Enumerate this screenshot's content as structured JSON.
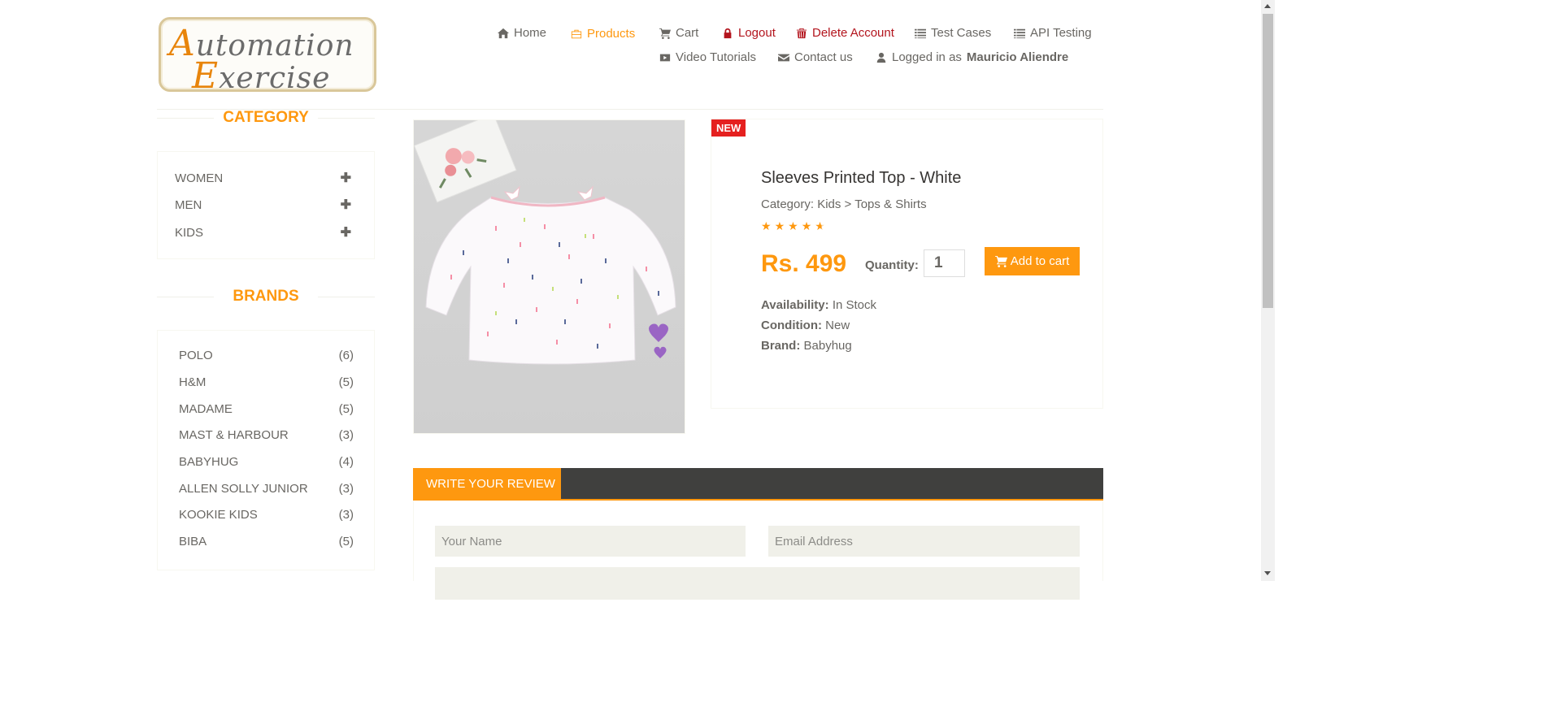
{
  "logo": {
    "line1_cap": "A",
    "line1_rest": "utomation",
    "line2_cap": "E",
    "line2_rest": "xercise"
  },
  "nav": {
    "home": "Home",
    "products": "Products",
    "cart": "Cart",
    "logout": "Logout",
    "delete_account": "Delete Account",
    "test_cases": "Test Cases",
    "api_testing": "API Testing",
    "video_tutorials": "Video Tutorials",
    "contact_us": "Contact us",
    "logged_in_prefix": "Logged in as",
    "logged_in_user": "Mauricio Aliendre"
  },
  "sidebar": {
    "category_title": "CATEGORY",
    "categories": [
      {
        "label": "WOMEN",
        "icon": "plus-icon"
      },
      {
        "label": "MEN",
        "icon": "plus-icon"
      },
      {
        "label": "KIDS",
        "icon": "plus-icon"
      }
    ],
    "brands_title": "BRANDS",
    "brands": [
      {
        "label": "POLO",
        "count": "(6)"
      },
      {
        "label": "H&M",
        "count": "(5)"
      },
      {
        "label": "MADAME",
        "count": "(5)"
      },
      {
        "label": "MAST & HARBOUR",
        "count": "(3)"
      },
      {
        "label": "BABYHUG",
        "count": "(4)"
      },
      {
        "label": "ALLEN SOLLY JUNIOR",
        "count": "(3)"
      },
      {
        "label": "KOOKIE KIDS",
        "count": "(3)"
      },
      {
        "label": "BIBA",
        "count": "(5)"
      }
    ]
  },
  "product": {
    "badge": "NEW",
    "name": "Sleeves Printed Top - White",
    "category": "Category: Kids > Tops & Shirts",
    "rating": 4.5,
    "price": "Rs. 499",
    "quantity_label": "Quantity:",
    "quantity_value": "1",
    "add_to_cart": "Add to cart",
    "availability_label": "Availability:",
    "availability": "In Stock",
    "condition_label": "Condition:",
    "condition": "New",
    "brand_label": "Brand:",
    "brand": "Babyhug"
  },
  "review": {
    "tab_label": "WRITE YOUR REVIEW",
    "name_placeholder": "Your Name",
    "email_placeholder": "Email Address"
  },
  "colors": {
    "accent": "#fe980f",
    "danger": "#b3141d",
    "badge": "#e5201f",
    "dark_bar": "#40403e"
  }
}
